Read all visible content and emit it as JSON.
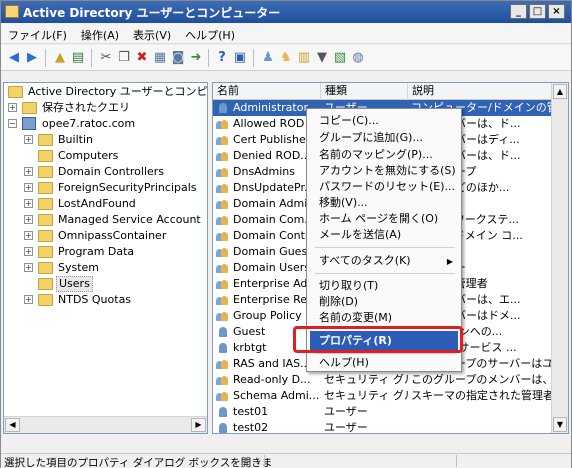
{
  "window": {
    "title": "Active Directory ユーザーとコンピューター",
    "min": "_",
    "max": "□",
    "close": "×"
  },
  "menu": [
    "ファイル(F)",
    "操作(A)",
    "表示(V)",
    "ヘルプ(H)"
  ],
  "toolbar_icons": [
    "back-icon",
    "forward-icon",
    "up-folder-icon",
    "properties-pane-icon",
    "cut-icon",
    "copy-icon",
    "delete-icon",
    "properties-icon",
    "refresh-icon",
    "export-icon",
    "help-icon",
    "console-icon",
    "new-user-icon",
    "new-group-icon",
    "new-ou-icon",
    "filter-icon",
    "add-to-group-icon",
    "find-icon"
  ],
  "tree": {
    "root": "Active Directory ユーザーとコンピュータ",
    "items": [
      {
        "label": "保存されたクエリ",
        "expander": "+"
      },
      {
        "label": "opee7.ratoc.com",
        "expander": "−"
      },
      {
        "label": "Builtin",
        "expander": "+"
      },
      {
        "label": "Computers",
        "expander": ""
      },
      {
        "label": "Domain Controllers",
        "expander": "+"
      },
      {
        "label": "ForeignSecurityPrincipals",
        "expander": "+"
      },
      {
        "label": "LostAndFound",
        "expander": "+"
      },
      {
        "label": "Managed Service Account",
        "expander": "+"
      },
      {
        "label": "OmnipassContainer",
        "expander": "+"
      },
      {
        "label": "Program Data",
        "expander": "+"
      },
      {
        "label": "System",
        "expander": "+"
      },
      {
        "label": "Users",
        "expander": ""
      },
      {
        "label": "NTDS Quotas",
        "expander": "+"
      }
    ]
  },
  "list": {
    "columns": [
      "名前",
      "種類",
      "説明"
    ],
    "rows": [
      {
        "name": "Administrator",
        "type": "ユーザー",
        "desc": "コンピューター/ドメインの管...",
        "icon": "user"
      },
      {
        "name": "Allowed ROD",
        "type": "",
        "desc": "プのメンバーは、ド...",
        "icon": "group"
      },
      {
        "name": "Cert Publishe",
        "type": "",
        "desc": "プのメンバーはディ...",
        "icon": "group"
      },
      {
        "name": "Denied ROD...",
        "type": "",
        "desc": "プのメンバーは、ド...",
        "icon": "group"
      },
      {
        "name": "DnsAdmins",
        "type": "",
        "desc": "理者グループ",
        "icon": "group"
      },
      {
        "name": "DnsUpdatePr...",
        "type": "",
        "desc": "ーバーなどのほか...",
        "icon": "group"
      },
      {
        "name": "Domain Admi",
        "type": "",
        "desc": "管理者",
        "icon": "group"
      },
      {
        "name": "Domain Com...",
        "type": "",
        "desc": "すべてのワークステ...",
        "icon": "group"
      },
      {
        "name": "Domain Contr",
        "type": "",
        "desc": "すべてのドメイン コ...",
        "icon": "group"
      },
      {
        "name": "Domain Gues",
        "type": "",
        "desc": "全ゲスト",
        "icon": "group"
      },
      {
        "name": "Domain Users",
        "type": "",
        "desc": "全ユーザー",
        "icon": "group"
      },
      {
        "name": "Enterprise Ad",
        "type": "",
        "desc": "ライズの管理者",
        "icon": "group"
      },
      {
        "name": "Enterprise Re",
        "type": "",
        "desc": "プのメンバーは、エ...",
        "icon": "group"
      },
      {
        "name": "Group Policy",
        "type": "",
        "desc": "プのメンバーはドメ...",
        "icon": "group"
      },
      {
        "name": "Guest",
        "type": "",
        "desc": "ー/ドメインへの...",
        "icon": "user"
      },
      {
        "name": "krbtgt",
        "type": "",
        "desc": "センター サービス ...",
        "icon": "user"
      },
      {
        "name": "RAS and IAS...",
        "type": "セキュリティ グル...",
        "desc": "このグループのサーバーはユ...",
        "icon": "group"
      },
      {
        "name": "Read-only D...",
        "type": "セキュリティ グル...",
        "desc": "このグループのメンバーは、ド...",
        "icon": "group"
      },
      {
        "name": "Schema Admi...",
        "type": "セキュリティ グル...",
        "desc": "スキーマの指定された管理者",
        "icon": "group"
      },
      {
        "name": "test01",
        "type": "ユーザー",
        "desc": "",
        "icon": "user"
      },
      {
        "name": "test02",
        "type": "ユーザー",
        "desc": "",
        "icon": "user"
      }
    ]
  },
  "context_menu": {
    "items": [
      "コピー(C)...",
      "グループに追加(G)...",
      "名前のマッピング(P)...",
      "アカウントを無効にする(S)",
      "パスワードのリセット(E)...",
      "移動(V)...",
      "ホーム ページを開く(O)",
      "メールを送信(A)",
      "すべてのタスク(K)",
      "切り取り(T)",
      "削除(D)",
      "名前の変更(M)",
      "プロパティ(R)",
      "ヘルプ(H)"
    ]
  },
  "status": {
    "text": "選択した項目のプロパティ ダイアログ ボックスを開きま"
  },
  "colors": {
    "selection": "#3163b5",
    "highlight_box": "#e02020",
    "titlebar": "#1f4f9c"
  }
}
